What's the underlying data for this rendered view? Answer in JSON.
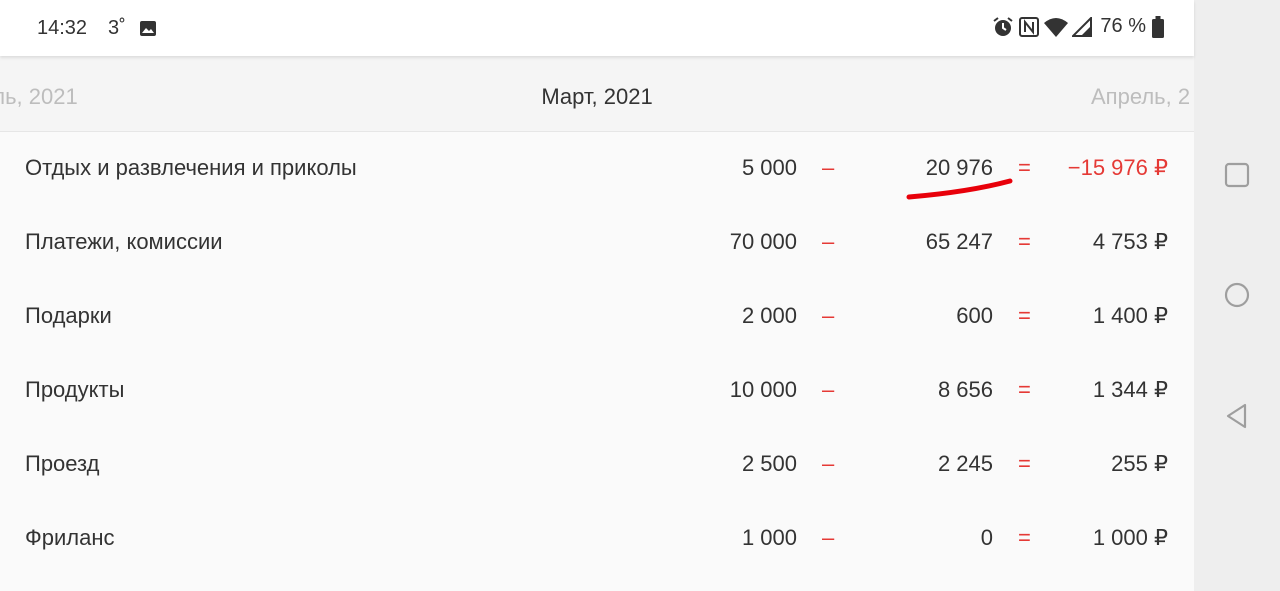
{
  "status_bar": {
    "time": "14:32",
    "temperature": "3˚",
    "battery": "76 %"
  },
  "month_nav": {
    "prev": "аль, 2021",
    "current": "Март, 2021",
    "next": "Апрель, 2"
  },
  "rows": [
    {
      "name": "Отдых и развлечения и приколы",
      "budget": "5 000",
      "minus": "–",
      "spent": "20 976",
      "eq": "=",
      "rest": "−15 976 ₽",
      "negative": true
    },
    {
      "name": "Платежи, комиссии",
      "budget": "70 000",
      "minus": "–",
      "spent": "65 247",
      "eq": "=",
      "rest": "4 753 ₽",
      "negative": false
    },
    {
      "name": "Подарки",
      "budget": "2 000",
      "minus": "–",
      "spent": "600",
      "eq": "=",
      "rest": "1 400 ₽",
      "negative": false
    },
    {
      "name": "Продукты",
      "budget": "10 000",
      "minus": "–",
      "spent": "8 656",
      "eq": "=",
      "rest": "1 344 ₽",
      "negative": false
    },
    {
      "name": "Проезд",
      "budget": "2 500",
      "minus": "–",
      "spent": "2 245",
      "eq": "=",
      "rest": "255 ₽",
      "negative": false
    },
    {
      "name": "Фриланс",
      "budget": "1 000",
      "minus": "–",
      "spent": "0",
      "eq": "=",
      "rest": "1 000 ₽",
      "negative": false
    }
  ],
  "colors": {
    "accent_red": "#e53935",
    "annotation_red": "#e8000a"
  },
  "icons": {
    "status": [
      "image-icon",
      "alarm-icon",
      "nfc-icon",
      "wifi-icon",
      "signal-icon",
      "battery-icon"
    ],
    "nav": [
      "recents-icon",
      "home-icon",
      "back-icon"
    ]
  }
}
